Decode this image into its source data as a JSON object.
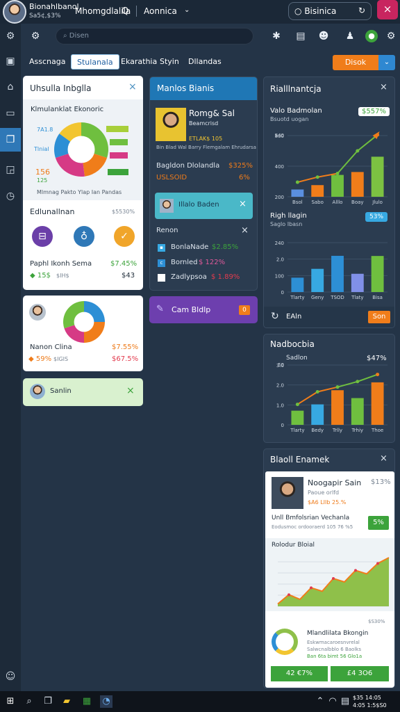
{
  "topbar": {
    "user_name": "Bionahlbanol",
    "user_sub": "Sa5¢,$3%",
    "app_title": "Mhomgdlalila",
    "search_icon_label": "Q",
    "menu_label": "Aonnica",
    "search_value": "Bisinica",
    "close_glyph": "×"
  },
  "toolbar": {
    "search_placeholder": "Disen"
  },
  "tabs": [
    "Asscnaga",
    "Stulanala",
    "Ekarathia",
    "Styin",
    "Dllandas"
  ],
  "action_button": {
    "label": "Disok"
  },
  "card1": {
    "title": "Uhsulla Inbglla",
    "subtitle": "Klmulanklat Ekonoric",
    "donut_labels": {
      "l1": "7A1.8",
      "l2": "Tlnial",
      "l3": "156",
      "l4": "125"
    },
    "footnote": "Mlmnag Pakto Ylap Ian Pandas",
    "summary_label": "Edlunallnan",
    "summary_value": "$5530%",
    "stat_label": "Paphl Ikonh Sema",
    "stat_value": "$7.45%",
    "stat_sub1": "◆ 15$",
    "stat_sub2": "$IH$",
    "stat_sub3": "$43"
  },
  "card2": {
    "label": "Nanon Clina",
    "value1": "$7.55%",
    "sub1": "◆ 59%",
    "sub2": "$IGIS",
    "value2": "$67.5%"
  },
  "card3": {
    "label": "Sanlin"
  },
  "mid": {
    "header": "Manlos Bianis",
    "person_name": "Romg& Sal",
    "person_role": "Beamcrisd",
    "person_line2": "ETLAK$ 105",
    "person_line3": "Bin  Blad Wal Barry Flemgalam Ehrudarsa",
    "row1_label": "Bagldon Dlolandla",
    "row1_value": "$325%",
    "row2_label": "USLSOID",
    "row2_value": "6%",
    "chip_label": "Illalo Baden",
    "list_title": "Renon",
    "list": [
      {
        "label": "BonlaNade",
        "value": "$2.85%"
      },
      {
        "label": "Bornled",
        "value": "$ 122%"
      },
      {
        "label": "Zadlypsoa",
        "value": "$ 1.89%"
      }
    ],
    "purple_label": "Cam Bldlp",
    "purple_badge": "0"
  },
  "right1": {
    "title": "Rialllnantcja",
    "sub_title": "Valo Badmolan",
    "sub_small": "Bsuotd uogan",
    "badge": "$557%",
    "sec2_title": "Righ llagin",
    "sec2_sub": "Saglo Ibasn",
    "sec2_badge": "53%",
    "footer_label": "EAln",
    "footer_btn": "Son"
  },
  "right2": {
    "title": "Nadbocbia",
    "sub": "Sadlon",
    "value": "$47%"
  },
  "right3": {
    "title": "Blaoll Enamek",
    "person_name": "Noogapir Sain",
    "person_pct": "$13%",
    "person_line1": "Paoue orlfd",
    "person_line2": "$A6 LIIb 25.%",
    "row_label": "Unll Bmfolsrian Vechanla",
    "row_sub": "Eodusmoc ordooraerd 105 76 %5",
    "row_badge": "5%",
    "chart_title": "Rolodur Bloial",
    "bottom_small": "$S30%",
    "bottom_title": "Mlandlilata Bkongin",
    "bottom_line1": "Eskwmacaroesnvrelal",
    "bottom_line2": "Salwcnalbblo 6 Baolks",
    "bottom_line3": "Ban 6ta bimt 56 Glo1a",
    "btn1": "42 €7%",
    "btn2": "£4 3O6"
  },
  "taskbar": {
    "time": "$35 14:05",
    "date": "4:05 1:5$S0"
  },
  "chart_data": [
    {
      "type": "bar",
      "title": "Valo Badmolan",
      "categories": [
        "Bsol",
        "Sabo",
        "Alllo",
        "Boay",
        "Jlulo"
      ],
      "values": [
        1,
        1.6,
        3,
        3.4,
        5.5
      ],
      "line": [
        2,
        2.7,
        3.2,
        6.3,
        8.5
      ],
      "ylim": [
        0,
        8.4
      ],
      "yticks": [
        "200",
        "400",
        "800"
      ],
      "extra_ytick": "S40",
      "colors": [
        "#5a8fe0",
        "#f07d1a",
        "#6fbf3f",
        "#f07d1a",
        "#7cc242"
      ]
    },
    {
      "type": "bar",
      "title": "Righ llagin",
      "categories": [
        "Tlarty",
        "Geny",
        "TSOD",
        "Tlaty",
        "Bisa"
      ],
      "values": [
        96,
        155,
        242,
        122,
        241
      ],
      "ylim": [
        0,
        330
      ],
      "yticks": [
        "0",
        "100",
        "2.0",
        "240"
      ],
      "colors": [
        "#2d8fd5",
        "#37a9e2",
        "#2d8fd5",
        "#8090e8",
        "#6fbf3f"
      ]
    },
    {
      "type": "bar",
      "title": "Nadbocbia",
      "categories": [
        "Tlarty",
        "Bedy",
        "Trlly",
        "Trhiy",
        "Thoe"
      ],
      "values": [
        0.9,
        1.3,
        2.2,
        1.7,
        2.7
      ],
      "line": [
        1.3,
        2.1,
        2.4,
        2.75,
        3.2
      ],
      "ylim": [
        0,
        3.8
      ],
      "yticks": [
        "0",
        "1.0",
        "2.0",
        "3.0"
      ],
      "extra_ytick": "50",
      "colors": [
        "#6fbf3f",
        "#37a9e2",
        "#f07d1a",
        "#6fbf3f",
        "#f07d1a"
      ]
    },
    {
      "type": "area",
      "title": "Rolodur Bloial",
      "x": [
        0,
        1,
        2,
        3,
        4,
        5,
        6,
        7,
        8,
        9,
        10
      ],
      "values": [
        0.2,
        1.0,
        0.6,
        1.6,
        1.3,
        2.4,
        2.1,
        3.1,
        2.8,
        3.7,
        4.2
      ],
      "ylim": [
        0,
        4.8
      ],
      "yticks": [
        "0",
        "1",
        "2",
        "3",
        "4"
      ]
    },
    {
      "type": "pie",
      "title": "Klmulanklat Ekonoric",
      "values": [
        30,
        18,
        22,
        15,
        15
      ],
      "colors": [
        "#6fbf3f",
        "#f07d1a",
        "#d63a85",
        "#2d8fd5",
        "#f2c530"
      ]
    },
    {
      "type": "pie",
      "title": "Nanon Clina",
      "values": [
        25,
        25,
        20,
        30
      ],
      "colors": [
        "#2d8fd5",
        "#f07d1a",
        "#d63a85",
        "#6fbf3f"
      ]
    }
  ]
}
